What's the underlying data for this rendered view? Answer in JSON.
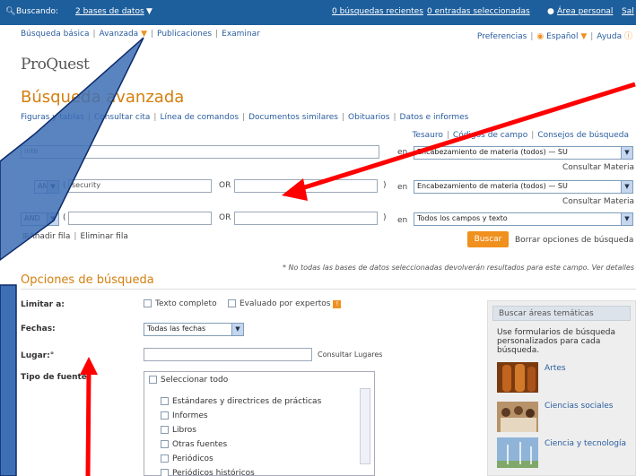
{
  "topbar": {
    "search_prefix": "Buscando:",
    "search_dbs": "2 bases de datos",
    "recent": "0 búsquedas recientes",
    "selected": "0 entradas seleccionadas",
    "account": "Área personal",
    "signout": "Sal"
  },
  "nav": {
    "basic": "Búsqueda básica",
    "advanced": "Avanzada",
    "publications": "Publicaciones",
    "browse": "Examinar",
    "preferences": "Preferencias",
    "language": "Español",
    "help": "Ayuda"
  },
  "logo": "ProQuest",
  "page_title": "Búsqueda avanzada",
  "sublinks": [
    "Figuras y tablas",
    "Consultar cita",
    "Línea de comandos",
    "Documentos similares",
    "Obituarios",
    "Datos e informes"
  ],
  "top_links": [
    "Tesauro",
    "Códigos de campo",
    "Consejos de búsqueda"
  ],
  "rows": [
    {
      "term": "inte",
      "field": "Encabezamiento de materia (todos) — SU",
      "in": "en",
      "consult": "Consultar Materia"
    },
    {
      "op": "AND",
      "paren": "(",
      "term1": "security",
      "or": "OR",
      "term2": "",
      "close": ")",
      "in": "en",
      "field": "Encabezamiento de materia (todos) — SU",
      "consult": "Consultar Materia"
    },
    {
      "op": "AND",
      "paren": "(",
      "term1": "",
      "or": "OR",
      "term2": "",
      "close": ")",
      "in": "en",
      "field": "Todos los campos y texto"
    }
  ],
  "add_row": "Añadir fila",
  "remove_row": "Eliminar fila",
  "search_button": "Buscar",
  "clear_link": "Borrar opciones de búsqueda",
  "note": "* No todas las bases de datos seleccionadas devolverán resultados para este campo. Ver detalles",
  "options_title": "Opciones de búsqueda",
  "limit_label": "Limitar a:",
  "full_text": "Texto completo",
  "peer_reviewed": "Evaluado por expertos",
  "dates_label": "Fechas:",
  "dates_value": "Todas las fechas",
  "place_label": "Lugar:°",
  "place_consult": "Consultar Lugares",
  "source_label": "Tipo de fuente:",
  "select_all": "Seleccionar todo",
  "sources": [
    "Estándares y directrices de prácticas",
    "Informes",
    "Libros",
    "Otras fuentes",
    "Periódicos",
    "Periódicos históricos"
  ],
  "panel": {
    "header": "Buscar áreas temáticas",
    "text": "Use formularios de búsqueda personalizados para cada búsqueda.",
    "topics": [
      "Artes",
      "Ciencias sociales",
      "Ciencia y tecnología"
    ]
  },
  "colors": {
    "topbar": "#1d5e9c",
    "accent": "#d47f0f",
    "link": "#2a5d9f",
    "button": "#f0901e",
    "arrow": "#ff0000",
    "callout": "#3d6fb5"
  }
}
